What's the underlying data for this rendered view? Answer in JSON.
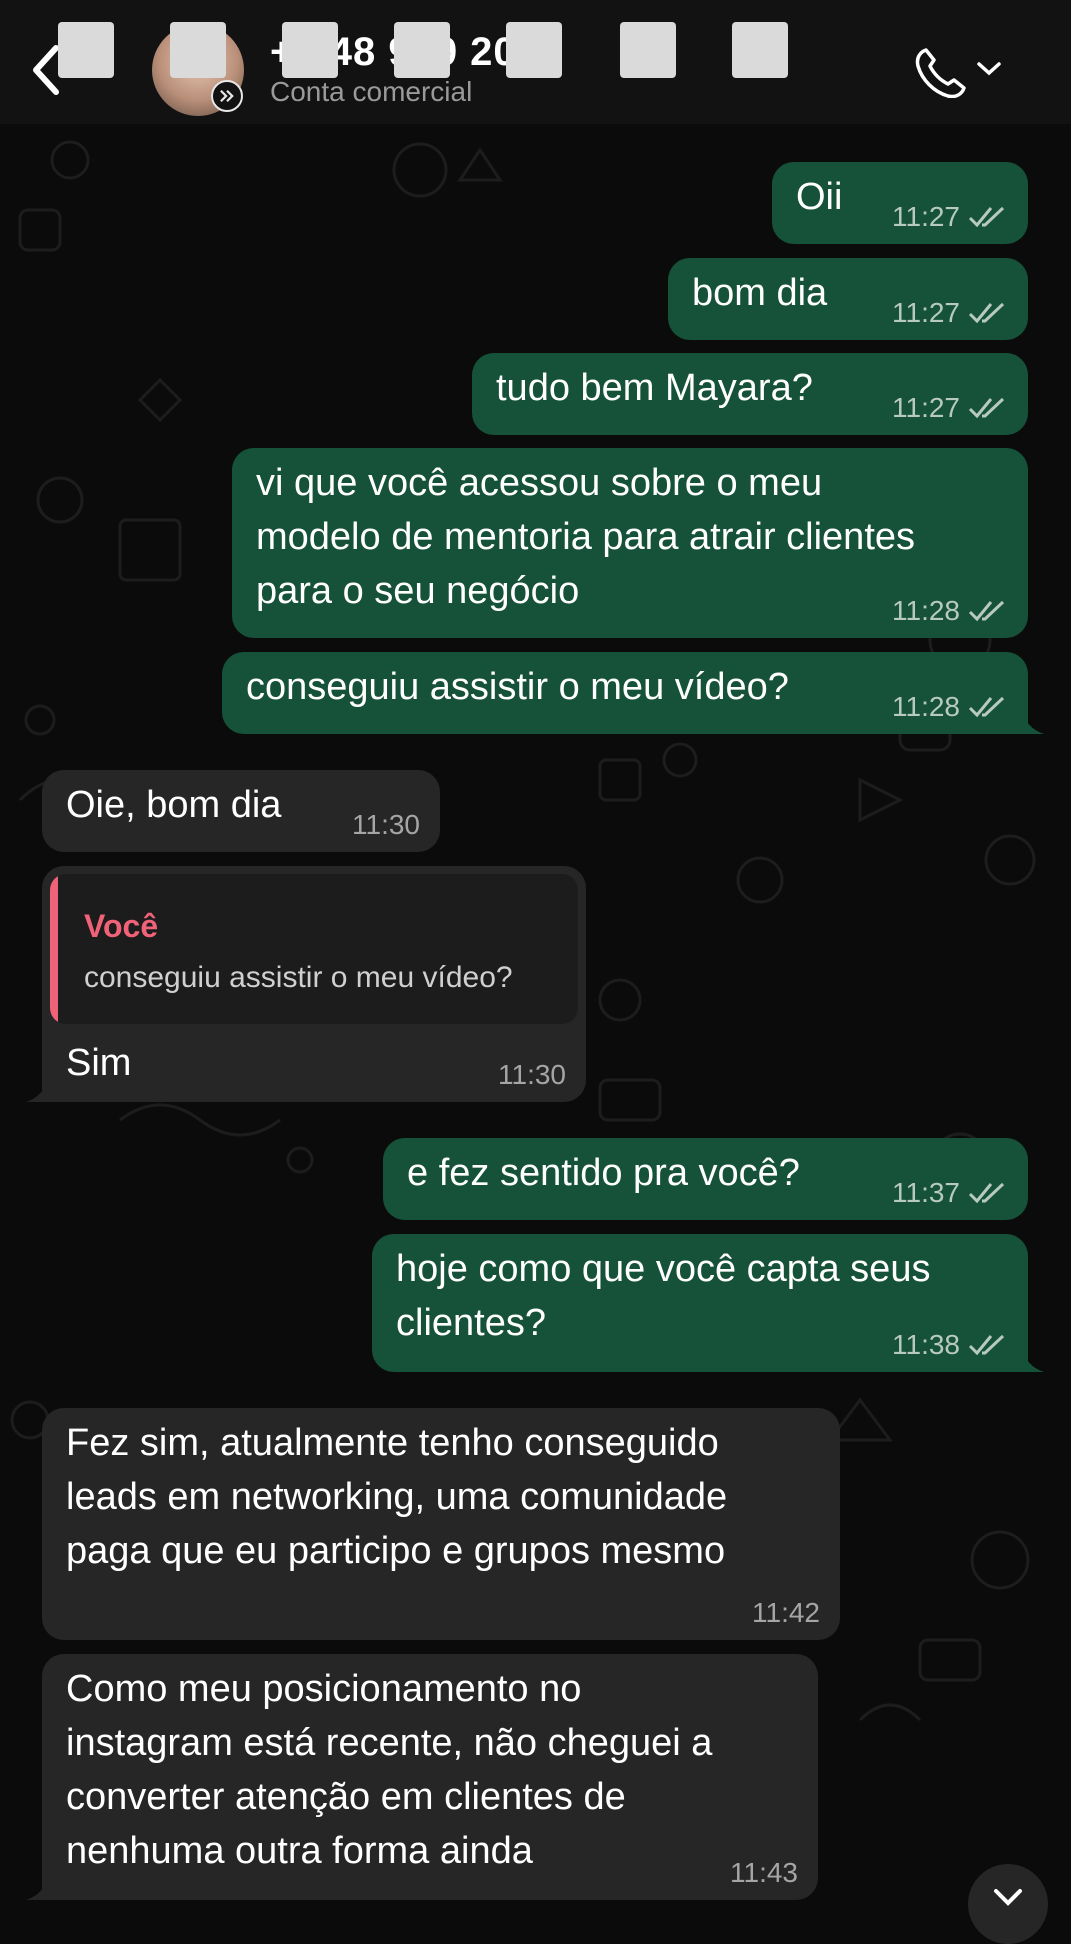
{
  "header": {
    "contact_name": "+5 48 919 209",
    "contact_subtitle": "Conta comercial",
    "back_icon": "chevron-left-icon",
    "call_icon": "phone-icon"
  },
  "messages": [
    {
      "dir": "out",
      "text": "Oii",
      "time": "11:27",
      "status": "read"
    },
    {
      "dir": "out",
      "text": "bom dia",
      "time": "11:27",
      "status": "read"
    },
    {
      "dir": "out",
      "text": "tudo bem Mayara?",
      "time": "11:27",
      "status": "read"
    },
    {
      "dir": "out",
      "text": "vi que você acessou sobre o meu\nmodelo de mentoria para atrair clientes\npara o seu negócio",
      "time": "11:28",
      "status": "read"
    },
    {
      "dir": "out",
      "text": "conseguiu assistir o meu vídeo?",
      "time": "11:28",
      "status": "read"
    },
    {
      "dir": "in",
      "text": "Oie, bom dia",
      "time": "11:30"
    },
    {
      "dir": "in",
      "text": "Sim",
      "time": "11:30",
      "reply_to": {
        "author": "Você",
        "text": "conseguiu assistir o meu vídeo?"
      }
    },
    {
      "dir": "out",
      "text": "e fez sentido pra você?",
      "time": "11:37",
      "status": "read"
    },
    {
      "dir": "out",
      "text": "hoje como que você capta seus\nclientes?",
      "time": "11:38",
      "status": "read"
    },
    {
      "dir": "in",
      "text": "Fez sim, atualmente tenho conseguido\nleads em networking, uma comunidade\npaga que eu participo e grupos mesmo",
      "time": "11:42"
    },
    {
      "dir": "in",
      "text": "Como meu posicionamento no\ninstagram está recente, não cheguei a\nconverter atenção em clientes de\nnenhuma outra forma ainda",
      "time": "11:43"
    }
  ],
  "colors": {
    "outgoing_bubble": "#155239",
    "incoming_bubble": "#262626",
    "reply_accent": "#f06277",
    "background": "#0b0b0b"
  }
}
